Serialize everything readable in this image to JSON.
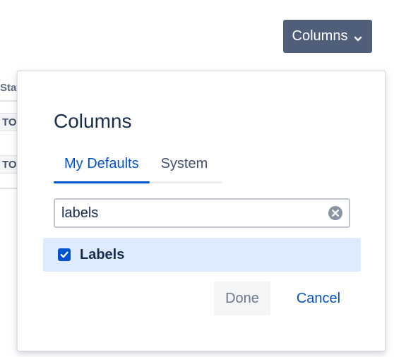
{
  "toolbar": {
    "columns_button_label": "Columns",
    "chevron_icon": "chevron-down-icon"
  },
  "background_table": {
    "header_partial": "Stat",
    "cells_partial": [
      "TO",
      "TO"
    ]
  },
  "dialog": {
    "title": "Columns",
    "tabs": [
      {
        "label": "My Defaults",
        "active": true
      },
      {
        "label": "System",
        "active": false
      }
    ],
    "search": {
      "value": "labels",
      "placeholder": "",
      "clear_icon": "clear-icon"
    },
    "options": [
      {
        "label": "Labels",
        "checked": true
      }
    ],
    "done_label": "Done",
    "cancel_label": "Cancel"
  },
  "colors": {
    "primary": "#0052cc",
    "button_dark": "#505f79",
    "selected_row": "#deebff",
    "text": "#172b4d"
  }
}
